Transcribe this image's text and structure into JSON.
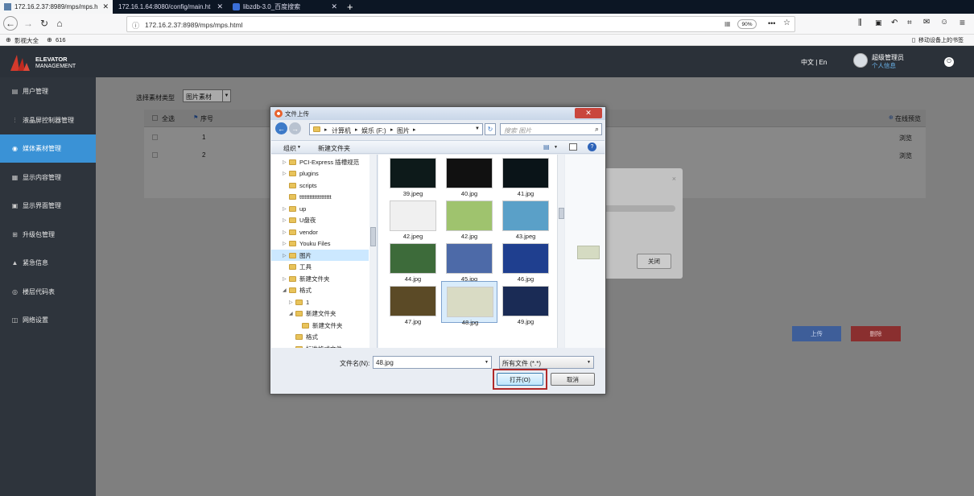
{
  "browser": {
    "tabs": [
      {
        "label": "172.16.2.37:8989/mps/mps.h",
        "active": true
      },
      {
        "label": "172.16.1.64:8080/config/main.ht",
        "active": false
      },
      {
        "label": "libzdb-3.0_百度搜索",
        "active": false
      }
    ],
    "new_tab": "+",
    "url": "172.16.2.37:8989/mps/mps.html",
    "zoom": "90%",
    "bookmarks": [
      {
        "label": "影视大全"
      },
      {
        "label": "616"
      }
    ],
    "mobile_bookmarks": "移动设备上的书签"
  },
  "app": {
    "logo_line1": "ELEVATOR",
    "logo_line2": "MANAGEMENT",
    "lang": "中文 | En",
    "user_name": "超级管理员",
    "user_link": "个人信息"
  },
  "sidebar": {
    "items": [
      {
        "label": "用户管理",
        "icon": "users-icon",
        "active": false
      },
      {
        "label": "液晶屏控制器管理",
        "icon": "sliders-icon",
        "active": false
      },
      {
        "label": "媒体素材管理",
        "icon": "media-icon",
        "active": true
      },
      {
        "label": "显示内容管理",
        "icon": "grid-icon",
        "active": false
      },
      {
        "label": "显示界面管理",
        "icon": "screen-icon",
        "active": false
      },
      {
        "label": "升级包管理",
        "icon": "upgrade-icon",
        "active": false
      },
      {
        "label": "紧急信息",
        "icon": "warning-icon",
        "active": false
      },
      {
        "label": "楼层代码表",
        "icon": "floor-icon",
        "active": false
      },
      {
        "label": "网络设置",
        "icon": "network-icon",
        "active": false
      }
    ]
  },
  "main": {
    "filter_label": "选择素材类型",
    "filter_value": "图片素材",
    "table": {
      "col_select": "全选",
      "col_index": "序号",
      "col_preview": "在线预览",
      "rows": [
        {
          "index": "1",
          "action": "浏览"
        },
        {
          "index": "2",
          "action": "浏览"
        }
      ]
    },
    "upload_button": "上传",
    "delete_button": "删除",
    "modal_close": "关闭",
    "modal_x": "×"
  },
  "dialog": {
    "title": "文件上传",
    "breadcrumb": [
      "计算机",
      "娱乐 (F:)",
      "图片"
    ],
    "search_placeholder": "搜索 图片",
    "organize": "组织",
    "new_folder": "新建文件夹",
    "tree": [
      {
        "label": "PCI-Express 插槽规范",
        "level": 1,
        "expand": "▷"
      },
      {
        "label": "plugins",
        "level": 1,
        "expand": "▷"
      },
      {
        "label": "scripts",
        "level": 1,
        "expand": ""
      },
      {
        "label": "ttttttttttttttttttt",
        "level": 1,
        "expand": ""
      },
      {
        "label": "up",
        "level": 1,
        "expand": "▷"
      },
      {
        "label": "U盘夜",
        "level": 1,
        "expand": "▷"
      },
      {
        "label": "vendor",
        "level": 1,
        "expand": "▷"
      },
      {
        "label": "Youku Files",
        "level": 1,
        "expand": "▷"
      },
      {
        "label": "图片",
        "level": 1,
        "expand": "▷",
        "selected": true
      },
      {
        "label": "工具",
        "level": 1,
        "expand": ""
      },
      {
        "label": "新建文件夹",
        "level": 1,
        "expand": "▷"
      },
      {
        "label": "格式",
        "level": 1,
        "expand": "◢"
      },
      {
        "label": "1",
        "level": 2,
        "expand": "▷"
      },
      {
        "label": "新建文件夹",
        "level": 2,
        "expand": "◢"
      },
      {
        "label": "新建文件夹",
        "level": 3,
        "expand": ""
      },
      {
        "label": "格式",
        "level": 2,
        "expand": ""
      },
      {
        "label": "标准格式文件",
        "level": 2,
        "expand": ""
      }
    ],
    "files": [
      {
        "name": "39.jpeg",
        "color": "#0d1a1a"
      },
      {
        "name": "40.jpg",
        "color": "#111111"
      },
      {
        "name": "41.jpg",
        "color": "#0a1418"
      },
      {
        "name": "42.jpeg",
        "color": "#f0f0f0"
      },
      {
        "name": "42.jpg",
        "color": "#9fc36e"
      },
      {
        "name": "43.jpeg",
        "color": "#5aa0c8"
      },
      {
        "name": "44.jpg",
        "color": "#3d6b3a"
      },
      {
        "name": "45.jpg",
        "color": "#4d6aa8"
      },
      {
        "name": "46.jpg",
        "color": "#1f3f8f"
      },
      {
        "name": "47.jpg",
        "color": "#5b4a26"
      },
      {
        "name": "48.jpg",
        "color": "#d9dbc4",
        "selected": true
      },
      {
        "name": "49.jpg",
        "color": "#1a2b55"
      }
    ],
    "filename_label": "文件名(N):",
    "filename_value": "48.jpg",
    "filetype_value": "所有文件 (*.*)",
    "open_button": "打开(O)",
    "cancel_button": "取消",
    "help_icon": "?"
  }
}
